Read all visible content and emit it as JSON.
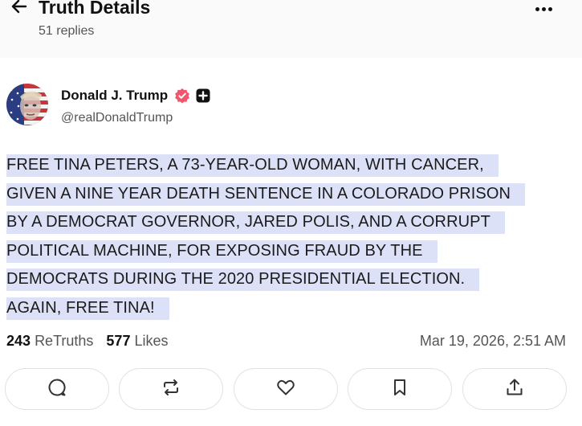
{
  "header": {
    "title": "Truth Details",
    "subtitle": "51 replies",
    "back_icon": "arrow-left-icon",
    "more_icon": "more-horizontal-icon"
  },
  "author": {
    "name": "Donald J. Trump",
    "handle": "@realDonaldTrump",
    "verified_badge_color": "#f0566d",
    "avatar": "flag-portrait-avatar"
  },
  "post": {
    "lines": [
      "FREE TINA PETERS, A 73-YEAR-OLD WOMAN, WITH CANCER,",
      "GIVEN A NINE YEAR DEATH SENTENCE IN A COLORADO PRISON",
      "BY A DEMOCRAT GOVERNOR, JARED POLIS, AND A CORRUPT",
      "POLITICAL MACHINE, FOR EXPOSING FRAUD BY THE",
      "DEMOCRATS DURING THE 2020 PRESIDENTIAL ELECTION.",
      "AGAIN, FREE TINA!"
    ],
    "highlight_color": "#dde1f8"
  },
  "stats": {
    "retruths_count": "243",
    "retruths_label": "ReTruths",
    "likes_count": "577",
    "likes_label": "Likes",
    "timestamp": "Mar 19, 2026, 2:51 AM"
  },
  "actions": [
    {
      "name": "reply-button",
      "icon": "reply-bubble-icon"
    },
    {
      "name": "retruth-button",
      "icon": "repost-icon"
    },
    {
      "name": "like-button",
      "icon": "heart-icon"
    },
    {
      "name": "bookmark-button",
      "icon": "bookmark-icon"
    },
    {
      "name": "share-button",
      "icon": "share-upload-icon"
    }
  ]
}
